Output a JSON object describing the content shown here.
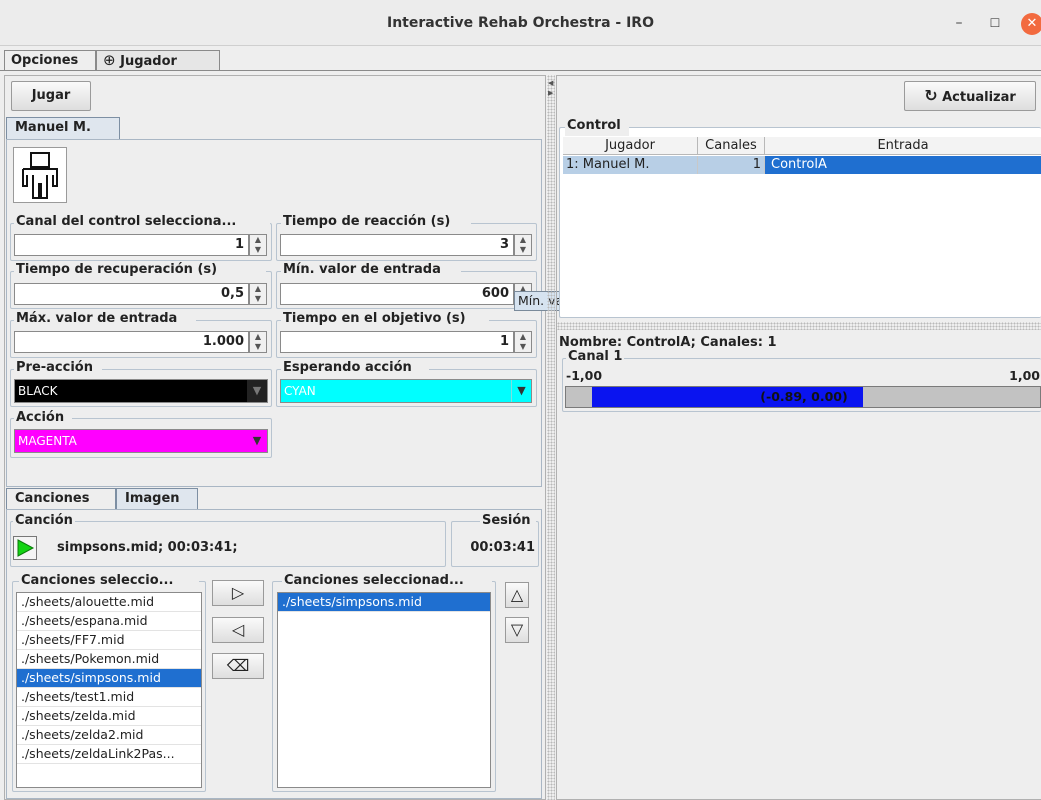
{
  "window": {
    "title": "Interactive Rehab Orchestra - IRO",
    "min_glyph": "–",
    "max_glyph": "☐",
    "close_glyph": "✕"
  },
  "menu": {
    "opciones": "Opciones",
    "jugador": "Jugador",
    "jugador_icon": "⊕"
  },
  "left": {
    "play_button": "Jugar",
    "player_tab": "Manuel M.",
    "fields": {
      "canal": {
        "label": "Canal del control selecciona...",
        "value": "1"
      },
      "reaccion": {
        "label": "Tiempo de reacción (s)",
        "value": "3"
      },
      "recuperacion": {
        "label": "Tiempo de recuperación (s)",
        "value": "0,5"
      },
      "min_entrada": {
        "label": "Mín. valor de entrada",
        "value": "600"
      },
      "max_entrada": {
        "label": "Máx. valor de entrada",
        "value": "1.000"
      },
      "objetivo": {
        "label": "Tiempo en el objetivo (s)",
        "value": "1"
      }
    },
    "tooltip": "Mín. valor de entrada",
    "pre_accion": {
      "label": "Pre-acción",
      "value": "BLACK",
      "color": "#000000"
    },
    "esperando": {
      "label": "Esperando acción",
      "value": "CYAN",
      "color": "#00ffff"
    },
    "accion": {
      "label": "Acción",
      "value": "MAGENTA",
      "color": "#ff00ff"
    }
  },
  "songs": {
    "tab_canciones": "Canciones",
    "tab_imagen": "Imagen",
    "cancion_label": "Canción",
    "current_song": "simpsons.mid; 00:03:41;",
    "sesion_label": "Sesión",
    "sesion_time": "00:03:41",
    "available_label": "Canciones seleccio...",
    "available": [
      "./sheets/alouette.mid",
      "./sheets/espana.mid",
      "./sheets/FF7.mid",
      "./sheets/Pokemon.mid",
      "./sheets/simpsons.mid",
      "./sheets/test1.mid",
      "./sheets/zelda.mid",
      "./sheets/zelda2.mid",
      "./sheets/zeldaLink2Pas..."
    ],
    "available_selected_index": 4,
    "selected_label": "Canciones seleccionad...",
    "selected": [
      "./sheets/simpsons.mid"
    ],
    "add_glyph": "▷",
    "remove_glyph": "◁",
    "clear_glyph": "⌫",
    "up_glyph": "△",
    "down_glyph": "▽"
  },
  "right": {
    "refresh_button": "Actualizar",
    "refresh_icon": "↻",
    "control_label": "Control",
    "table": {
      "headers": [
        "Jugador",
        "Canales",
        "Entrada"
      ],
      "rows": [
        [
          "1: Manuel M.",
          "1",
          "ControlA"
        ]
      ]
    },
    "info_title": "Nombre: ControlA; Canales: 1",
    "canal_label": "Canal 1",
    "range_min": "-1,00",
    "range_max": "1,00",
    "bar_text": "(-0.89, 0.00)",
    "bar_fill_fraction": 0.055,
    "bar_color": "#0a14f0"
  }
}
